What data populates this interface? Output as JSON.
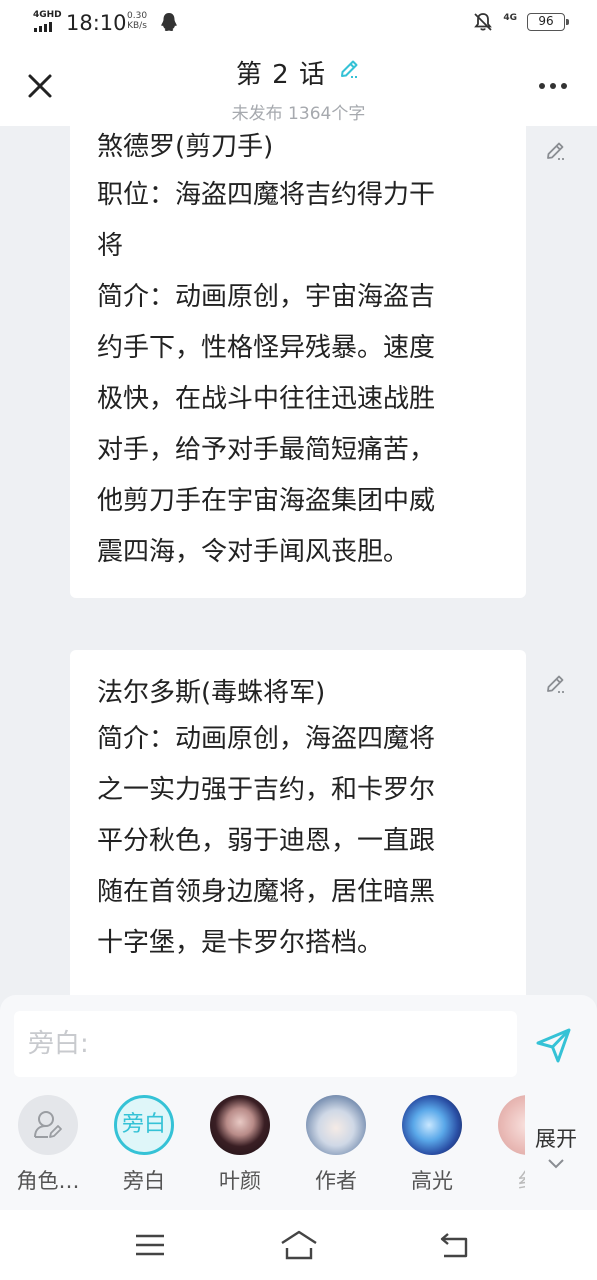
{
  "status_bar": {
    "network": "4GHD",
    "time": "18:10",
    "speed_value": "0.30",
    "speed_unit": "KB/s",
    "mobile": "4G",
    "battery": "96"
  },
  "header": {
    "title": "第 2 话",
    "subtitle": "未发布 1364个字",
    "icons": {
      "close": "close-icon",
      "edit": "edit-pencil-icon",
      "more": "more-dots-icon"
    }
  },
  "cards": [
    {
      "name": "煞德罗(剪刀手)",
      "lines": [
        "职位：海盗四魔将吉约得力干",
        "将",
        "简介：动画原创，宇宙海盗吉",
        "约手下，性格怪异残暴。速度",
        "极快，在战斗中往往迅速战胜",
        "对手，给予对手最简短痛苦，",
        "他剪刀手在宇宙海盗集团中威",
        "震四海，令对手闻风丧胆。"
      ]
    },
    {
      "name": "法尔多斯(毒蛛将军)",
      "lines": [
        "简介：动画原创，海盗四魔将",
        "之一实力强于吉约，和卡罗尔",
        "平分秋色，弱于迪恩，一直跟",
        "随在首领身边魔将，居住暗黑",
        "十字堡，是卡罗尔搭档。"
      ]
    }
  ],
  "input": {
    "placeholder": "旁白:"
  },
  "characters": [
    {
      "label": "角色…",
      "icon": "user-edit-icon"
    },
    {
      "label": "旁白",
      "avatar_text": "旁白"
    },
    {
      "label": "叶颜"
    },
    {
      "label": "作者"
    },
    {
      "label": "高光"
    },
    {
      "label": "纟"
    }
  ],
  "expand": {
    "label": "展开"
  },
  "colors": {
    "accent": "#35c2d6",
    "background": "#eef0f3"
  }
}
